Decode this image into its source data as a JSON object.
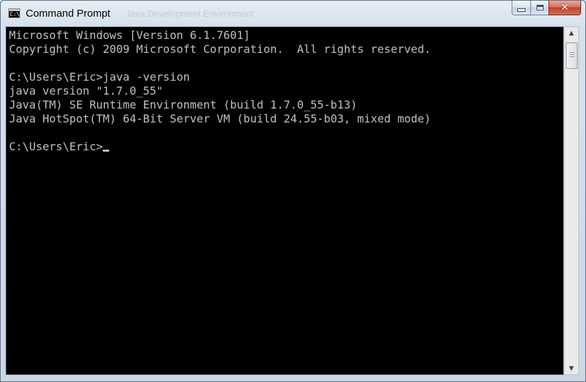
{
  "window": {
    "title": "Command Prompt",
    "background_title": "Java Development Environment",
    "icon_glyph": "C:\\",
    "close_glyph": "✕"
  },
  "console": {
    "lines": [
      "Microsoft Windows [Version 6.1.7601]",
      "Copyright (c) 2009 Microsoft Corporation.  All rights reserved.",
      "",
      "C:\\Users\\Eric>java -version",
      "java version \"1.7.0_55\"",
      "Java(TM) SE Runtime Environment (build 1.7.0_55-b13)",
      "Java HotSpot(TM) 64-Bit Server VM (build 24.55-b03, mixed mode)",
      ""
    ],
    "prompt": "C:\\Users\\Eric>",
    "text_color": "#c0c0c0",
    "background_color": "#000000"
  },
  "scrollbar": {
    "up_glyph": "▲",
    "down_glyph": "▼"
  }
}
